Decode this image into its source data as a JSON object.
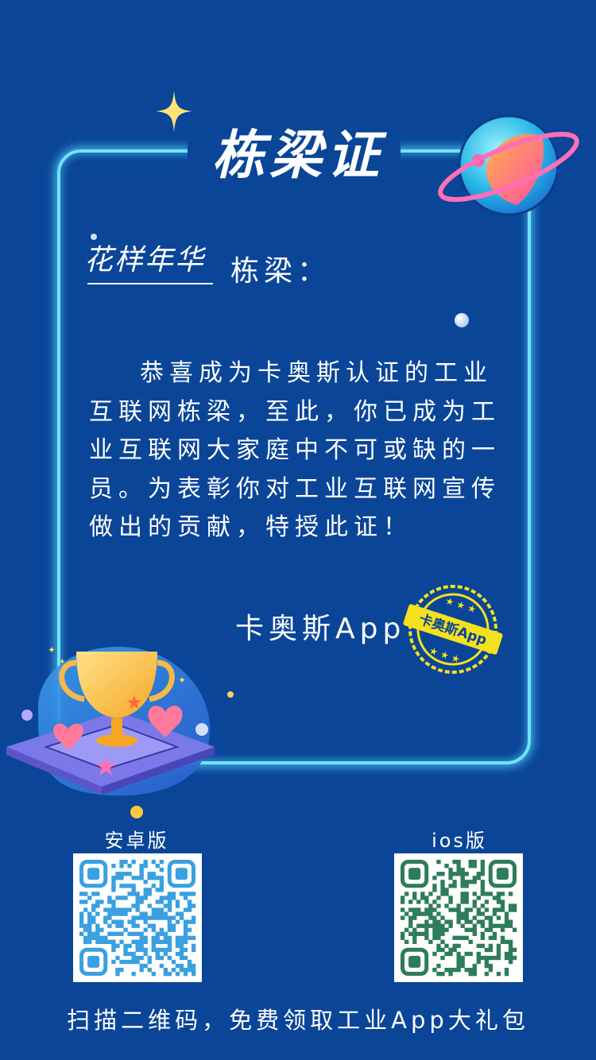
{
  "certificate": {
    "title": "栋梁证",
    "recipient_name": "花样年华",
    "recipient_suffix": "栋梁：",
    "body": "恭喜成为卡奥斯认证的工业互联网栋梁，至此，你已成为工业互联网大家庭中不可或缺的一员。为表彰你对工业互联网宣传做出的贡献，特授此证！",
    "issuer": "卡奥斯App",
    "seal_text": "卡奥斯App"
  },
  "downloads": {
    "android_label": "安卓版",
    "ios_label": "ios版",
    "android_qr_icon": "qr-code-icon",
    "ios_qr_icon": "qr-code-icon"
  },
  "footer": {
    "text": "扫描二维码，免费领取工业App大礼包"
  },
  "colors": {
    "background": "#0a4598",
    "neon": "#6fe3ff",
    "seal": "#f4e11e",
    "android_qr": "#3aa0e0",
    "ios_qr": "#2e7d5a"
  }
}
